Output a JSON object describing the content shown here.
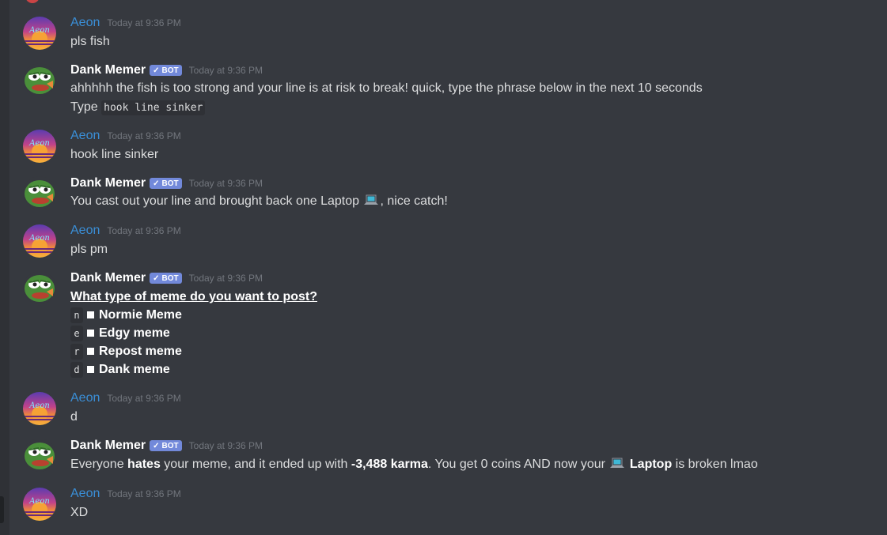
{
  "users": {
    "aeon": {
      "name": "Aeon",
      "color": "#3a8ed6"
    },
    "bot": {
      "name": "Dank Memer",
      "tag": "BOT",
      "color": "#ffffff"
    }
  },
  "timestamp": "Today at 9:36 PM",
  "messages": [
    {
      "text": "pls fish"
    },
    {
      "line1": "ahhhhh the fish is too strong and your line is at risk to break! quick, type the phrase below in the next 10 seconds",
      "type_prefix": "Type",
      "code": "hook line sinker"
    },
    {
      "text": "hook line sinker"
    },
    {
      "pre": "You cast out your line and brought back one Laptop",
      "post": ", nice catch!",
      "emoji": "laptop-icon"
    },
    {
      "text": "pls pm"
    },
    {
      "question": "What type of meme do you want to post?",
      "options": [
        {
          "key": "n",
          "label": "Normie Meme"
        },
        {
          "key": "e",
          "label": "Edgy meme"
        },
        {
          "key": "r",
          "label": "Repost meme"
        },
        {
          "key": "d",
          "label": "Dank meme"
        }
      ]
    },
    {
      "text": "d"
    },
    {
      "p1": "Everyone ",
      "b1": "hates",
      "p2": " your meme, and it ended up with ",
      "b2": "-3,488 karma",
      "p3": ". You get 0 coins AND now your ",
      "b3": "Laptop",
      "p4": " is broken lmao"
    },
    {
      "text": "XD"
    }
  ],
  "colors": {
    "background": "#36393f",
    "bot_tag": "#7289da",
    "timestamp": "#72767d",
    "text": "#dcddde"
  }
}
